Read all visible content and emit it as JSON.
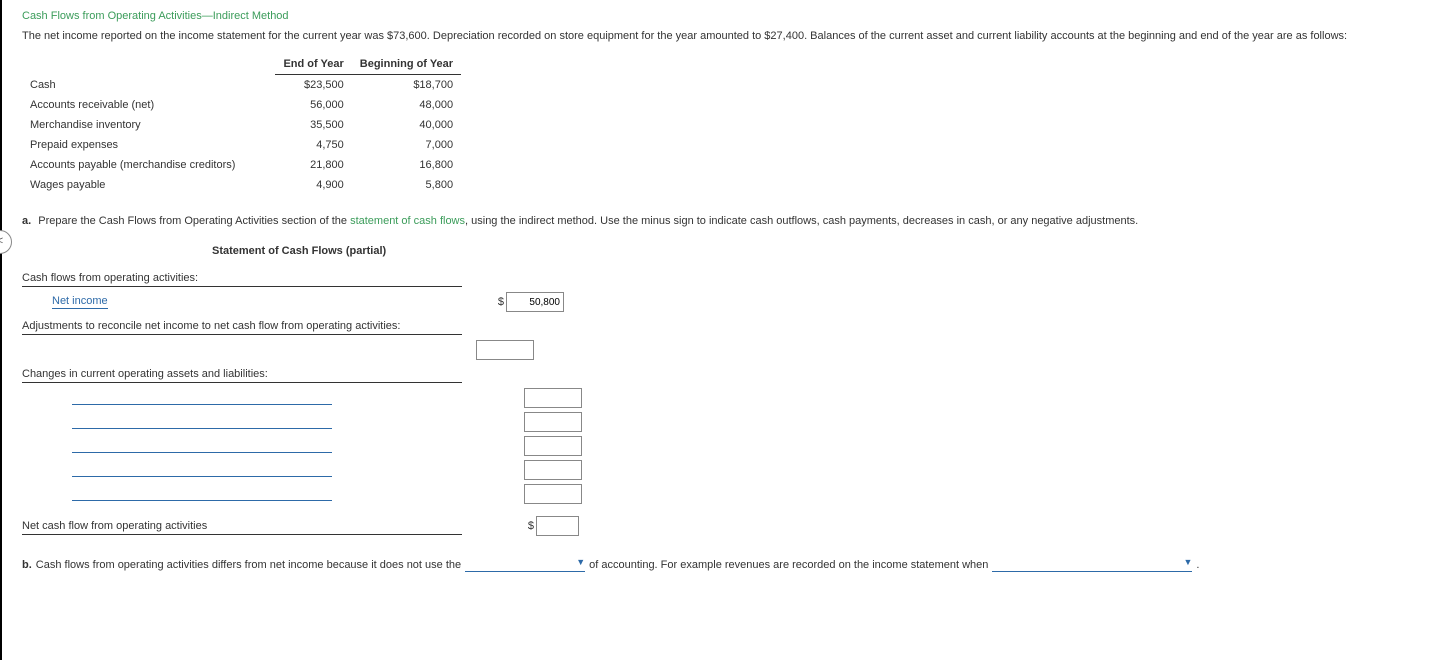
{
  "title": "Cash Flows from Operating Activities—Indirect Method",
  "intro": "The net income reported on the income statement for the current year was $73,600. Depreciation recorded on store equipment for the year amounted to $27,400. Balances of the current asset and current liability accounts at the beginning and end of the year are as follows:",
  "table": {
    "headers": {
      "c0": "",
      "c1": "End of Year",
      "c2": "Beginning of Year"
    },
    "rows": [
      {
        "label": "Cash",
        "end": "$23,500",
        "beg": "$18,700"
      },
      {
        "label": "Accounts receivable (net)",
        "end": "56,000",
        "beg": "48,000"
      },
      {
        "label": "Merchandise inventory",
        "end": "35,500",
        "beg": "40,000"
      },
      {
        "label": "Prepaid expenses",
        "end": "4,750",
        "beg": "7,000"
      },
      {
        "label": "Accounts payable (merchandise creditors)",
        "end": "21,800",
        "beg": "16,800"
      },
      {
        "label": "Wages payable",
        "end": "4,900",
        "beg": "5,800"
      }
    ]
  },
  "qa": {
    "a_pre": "Prepare the Cash Flows from Operating Activities section of the ",
    "a_link": "statement of cash flows",
    "a_post": ", using the indirect method. Use the minus sign to indicate cash outflows, cash payments, decreases in cash, or any negative adjustments.",
    "stmt_title": "Statement of Cash Flows (partial)",
    "lines": {
      "ops_header": "Cash flows from operating activities:",
      "net_income": "Net income",
      "net_income_val": "50,800",
      "adjustments": "Adjustments to reconcile net income to net cash flow from operating activities:",
      "changes": "Changes in current operating assets and liabilities:",
      "net_cash": "Net cash flow from operating activities"
    },
    "b_pre": "Cash flows from operating activities differs from net income because it does not use the",
    "b_mid": "of accounting. For example revenues are recorded on the income statement when",
    "b_post": "."
  },
  "nav_hint": "<",
  "dollar": "$"
}
